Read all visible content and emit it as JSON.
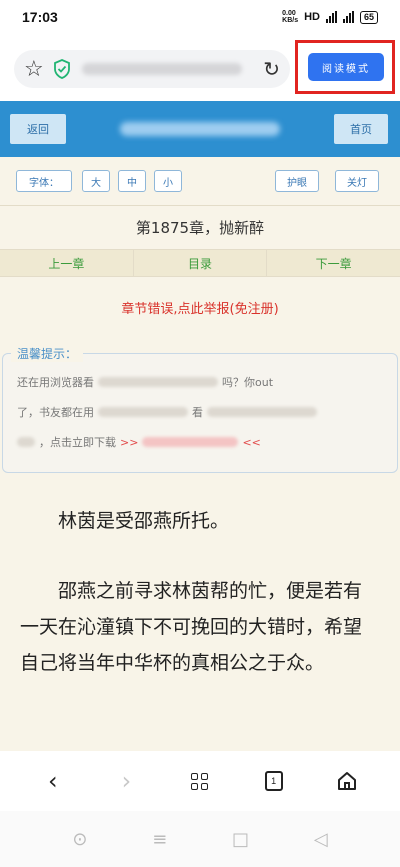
{
  "status": {
    "time": "17:03",
    "net_speed": "0.00\nKB/s",
    "hd": "HD",
    "battery": "65"
  },
  "browser": {
    "reader_button_label": "阅读模式"
  },
  "site": {
    "back_label": "返回",
    "home_label": "首页",
    "font_label": "字体：",
    "font_large": "大",
    "font_medium": "中",
    "font_small": "小",
    "eye_care_label": "护眼",
    "night_label": "关灯"
  },
  "chapter": {
    "title": "第1875章，抛新醉",
    "prev_label": "上一章",
    "toc_label": "目录",
    "next_label": "下一章",
    "report_text": "章节错误,点此举报(免注册)"
  },
  "tip": {
    "title": "温馨提示：",
    "line1_start": "还在用浏览器看",
    "line1_end": "吗？你out",
    "line2_start": "了，书友都在用",
    "line2_mid": "看",
    "line3_start": "，点击立即下载",
    "arrows_left": ">>",
    "arrows_right": "<<"
  },
  "content": {
    "para1": "林茵是受邵燕所托。",
    "para2": "邵燕之前寻求林茵帮的忙，便是若有一天在沁潼镇下不可挽回的大错时，希望自己将当年中华杯的真相公之于众。"
  },
  "nav": {
    "tabs_count": "1"
  }
}
